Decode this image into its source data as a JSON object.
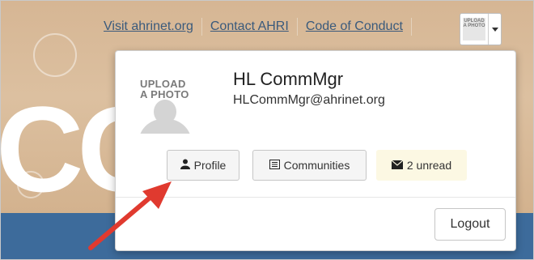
{
  "header": {
    "links": [
      {
        "label": "Visit ahrinet.org"
      },
      {
        "label": "Contact AHRI"
      },
      {
        "label": "Code of Conduct"
      }
    ],
    "avatar_text": "UPLOAD A PHOTO"
  },
  "banner": {
    "letters": "CC"
  },
  "user_menu": {
    "photo_text_line1": "UPLOAD",
    "photo_text_line2": "A PHOTO",
    "name": "HL CommMgr",
    "email": "HLCommMgr@ahrinet.org",
    "buttons": {
      "profile": "Profile",
      "communities": "Communities",
      "unread": "2 unread"
    },
    "logout": "Logout"
  },
  "colors": {
    "banner_tan": "#d6b694",
    "banner_blue": "#3d6b9b",
    "unread_bg": "#fcf8e3",
    "arrow_red": "#e03a2f",
    "link": "#3a5a7c"
  },
  "icons": {
    "profile": "user-icon",
    "communities": "list-icon",
    "unread": "envelope-icon",
    "menu": "caret-down-icon"
  }
}
